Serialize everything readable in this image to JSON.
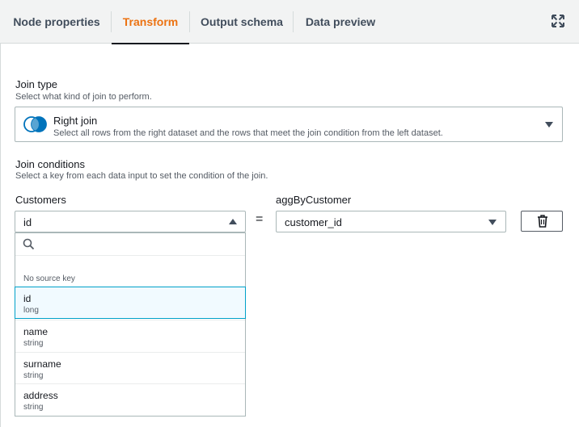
{
  "tabs": [
    {
      "label": "Node properties"
    },
    {
      "label": "Transform"
    },
    {
      "label": "Output schema"
    },
    {
      "label": "Data preview"
    }
  ],
  "join_type": {
    "label": "Join type",
    "description": "Select what kind of join to perform.",
    "selected_title": "Right join",
    "selected_description": "Select all rows from the right dataset and the rows that meet the join condition from the left dataset."
  },
  "join_conditions": {
    "label": "Join conditions",
    "description": "Select a key from each data input to set the condition of the join.",
    "left_label": "Customers",
    "left_value": "id",
    "operator": "=",
    "right_label": "aggByCustomer",
    "right_value": "customer_id"
  },
  "dropdown": {
    "group_label": "No source key",
    "options": [
      {
        "name": "id",
        "type": "long"
      },
      {
        "name": "name",
        "type": "string"
      },
      {
        "name": "surname",
        "type": "string"
      },
      {
        "name": "address",
        "type": "string"
      }
    ]
  },
  "colors": {
    "active_tab": "#ec7211",
    "selected_border": "#00a1c9",
    "venn_fill": "#0073bb"
  }
}
